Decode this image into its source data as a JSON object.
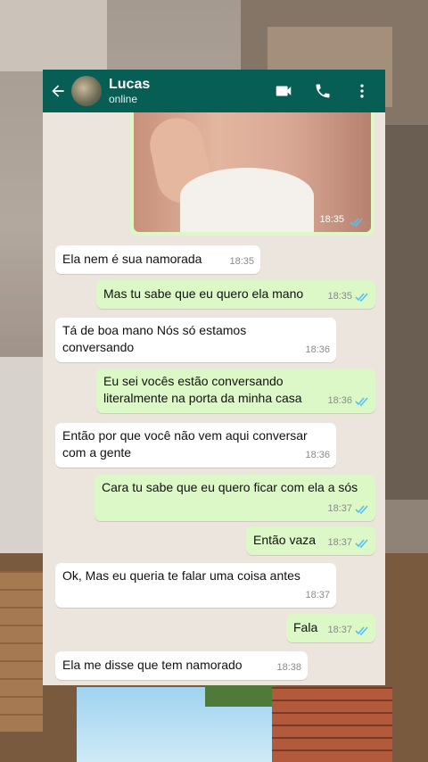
{
  "header": {
    "contact_name": "Lucas",
    "status": "online"
  },
  "image_message": {
    "time": "18:35"
  },
  "messages": [
    {
      "dir": "in",
      "text": "Ela nem é sua namorada",
      "time": "18:35"
    },
    {
      "dir": "out",
      "text": "Mas tu sabe que eu quero ela mano",
      "time": "18:35"
    },
    {
      "dir": "in",
      "text": "Tá de boa mano Nós só estamos conversando",
      "time": "18:36"
    },
    {
      "dir": "out",
      "text": "Eu sei vocês estão conversando literalmente na porta da minha casa",
      "time": "18:36"
    },
    {
      "dir": "in",
      "text": "Então por que você não vem aqui conversar com a gente",
      "time": "18:36"
    },
    {
      "dir": "out",
      "text": "Cara tu sabe que eu quero ficar com ela a sós",
      "time": "18:37"
    },
    {
      "dir": "out",
      "text": "Então vaza",
      "time": "18:37"
    },
    {
      "dir": "in",
      "text": "Ok, Mas eu queria te falar uma coisa antes",
      "time": "18:37"
    },
    {
      "dir": "out",
      "text": "Fala",
      "time": "18:37"
    },
    {
      "dir": "in",
      "text": "Ela me disse que tem namorado",
      "time": "18:38"
    }
  ],
  "icons": {
    "back": "arrow-left-icon",
    "video": "video-call-icon",
    "phone": "phone-icon",
    "menu": "more-vert-icon",
    "read": "double-check-icon"
  },
  "colors": {
    "header": "#075e54",
    "outgoing_bubble": "#dcf8c6",
    "incoming_bubble": "#ffffff",
    "read_ticks": "#4fc3f7"
  }
}
